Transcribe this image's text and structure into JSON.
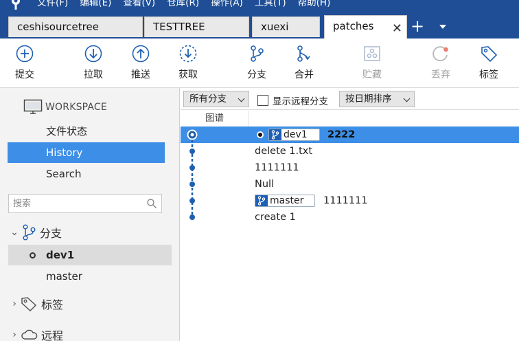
{
  "menu": [
    "文件(F)",
    "编辑(E)",
    "查看(V)",
    "仓库(R)",
    "操作(A)",
    "工具(T)",
    "帮助(H)"
  ],
  "tabs": [
    {
      "label": "ceshisourcetree"
    },
    {
      "label": "TESTTREE"
    },
    {
      "label": "xuexi"
    },
    {
      "label": "patches",
      "active": true
    }
  ],
  "tab_add": "+",
  "tab_close": "✕",
  "toolbar": {
    "commit": "提交",
    "pull": "拉取",
    "push": "推送",
    "fetch": "获取",
    "branch": "分支",
    "merge": "合并",
    "stash": "贮藏",
    "discard": "丢弃",
    "tag": "标签"
  },
  "sidebar": {
    "workspace_label": "WORKSPACE",
    "items": [
      {
        "label": "文件状态"
      },
      {
        "label": "History",
        "selected": true
      },
      {
        "label": "Search"
      }
    ],
    "search_placeholder": "搜索",
    "branches_label": "分支",
    "branches": [
      {
        "name": "dev1",
        "current": true
      },
      {
        "name": "master"
      }
    ],
    "tags_label": "标签",
    "remotes_label": "远程"
  },
  "filterbar": {
    "branch_filter": "所有分支",
    "show_remote": "显示远程分支",
    "show_remote_checked": false,
    "sort": "按日期排序"
  },
  "columns": {
    "graph": "图谱"
  },
  "commits": [
    {
      "message": "2222",
      "refs": [
        "dev1"
      ],
      "head": true,
      "selected": true
    },
    {
      "message": "delete 1.txt",
      "refs": []
    },
    {
      "message": "1111111",
      "refs": []
    },
    {
      "message": "Null",
      "refs": []
    },
    {
      "message": "1111111",
      "refs": [
        "master"
      ]
    },
    {
      "message": "create 1",
      "refs": []
    }
  ],
  "colors": {
    "titlebar": "#1f4e96",
    "selection": "#3c8ee6",
    "graph": "#1f5fb0"
  }
}
